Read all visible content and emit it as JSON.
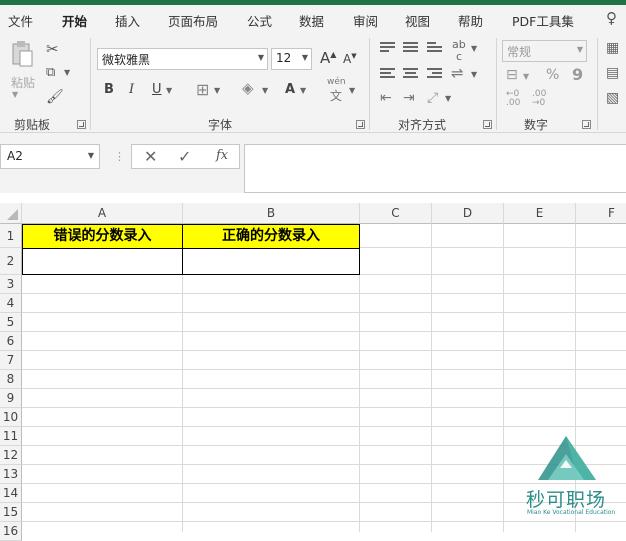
{
  "menu": [
    "文件",
    "开始",
    "插入",
    "页面布局",
    "公式",
    "数据",
    "审阅",
    "视图",
    "帮助",
    "PDF工具集"
  ],
  "active_menu": "开始",
  "ribbon": {
    "clipboard": {
      "label": "剪贴板",
      "paste": "粘贴"
    },
    "font": {
      "label": "字体",
      "font_name": "微软雅黑",
      "font_size": "12",
      "bold": "B",
      "italic": "I",
      "underline": "U",
      "grow": "A",
      "shrink": "A",
      "color_a": "A",
      "pinyin_top": "wén",
      "pinyin_bottom": "文"
    },
    "alignment": {
      "label": "对齐方式",
      "orient": "ab",
      "orient2": "c"
    },
    "number": {
      "label": "数字",
      "format": "常规",
      "percent": "%",
      "comma": "9",
      "inc_decimal": "←0 .00",
      "dec_decimal": ".00 →0"
    }
  },
  "formula_bar": {
    "name_box": "A2",
    "cancel": "✕",
    "enter": "✓",
    "fx": "fx",
    "formula": ""
  },
  "columns": [
    "A",
    "B",
    "C",
    "D",
    "E",
    "F"
  ],
  "rows": [
    "1",
    "2",
    "3",
    "4",
    "5",
    "6",
    "7",
    "8",
    "9",
    "10",
    "11",
    "12",
    "13",
    "14",
    "15",
    "16"
  ],
  "cells": {
    "A1": "错误的分数录入",
    "B1": "正确的分数录入"
  },
  "colors": {
    "accent": "#217346",
    "header_fill": "#ffff00"
  },
  "watermark": {
    "name": "秒可职场",
    "sub": "Miao Ke Vocational Education"
  }
}
